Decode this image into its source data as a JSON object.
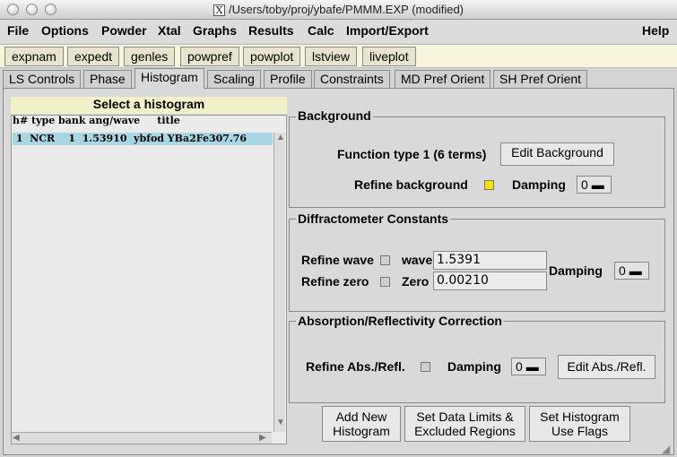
{
  "window": {
    "title": "/Users/toby/proj/ybafe/PMMM.EXP (modified)"
  },
  "menu": {
    "file": "File",
    "options": "Options",
    "powder": "Powder",
    "xtal": "Xtal",
    "graphs": "Graphs",
    "results": "Results",
    "calc": "Calc",
    "importexport": "Import/Export",
    "help": "Help"
  },
  "toolbar": {
    "expnam": "expnam",
    "expedt": "expedt",
    "genles": "genles",
    "powpref": "powpref",
    "powplot": "powplot",
    "lstview": "lstview",
    "liveplot": "liveplot"
  },
  "tabs": {
    "ls": "LS Controls",
    "phase": "Phase",
    "histogram": "Histogram",
    "scaling": "Scaling",
    "profile": "Profile",
    "constraints": "Constraints",
    "md": "MD Pref Orient",
    "sh": "SH Pref Orient"
  },
  "histlist": {
    "header": "Select a histogram",
    "columns": "h# type bank ang/wave     title",
    "row": " 1  NCR    1  1.53910  ybfod YBa2Fe307.76"
  },
  "background": {
    "title": "Background",
    "function_type": "Function type 1 (6 terms)",
    "edit_button": "Edit Background",
    "refine_label": "Refine background",
    "damping_label": "Damping",
    "damping_value": "0",
    "refine_checked": true
  },
  "diffractometer": {
    "title": "Diffractometer Constants",
    "refine_wave": "Refine wave",
    "wave_label": "wave",
    "wave_value": "1.5391",
    "refine_zero": "Refine zero",
    "zero_label": "Zero",
    "zero_value": "0.00210",
    "damping_label": "Damping",
    "damping_value": "0"
  },
  "absorption": {
    "title": "Absorption/Reflectivity Correction",
    "refine_label": "Refine Abs./Refl.",
    "damping_label": "Damping",
    "damping_value": "0",
    "edit_button": "Edit Abs./Refl."
  },
  "bottom": {
    "add_new_1": "Add New",
    "add_new_2": "Histogram",
    "limits_1": "Set Data Limits &",
    "limits_2": "Excluded Regions",
    "flags_1": "Set Histogram",
    "flags_2": "Use Flags"
  },
  "icons": {
    "window_icon": "X"
  }
}
